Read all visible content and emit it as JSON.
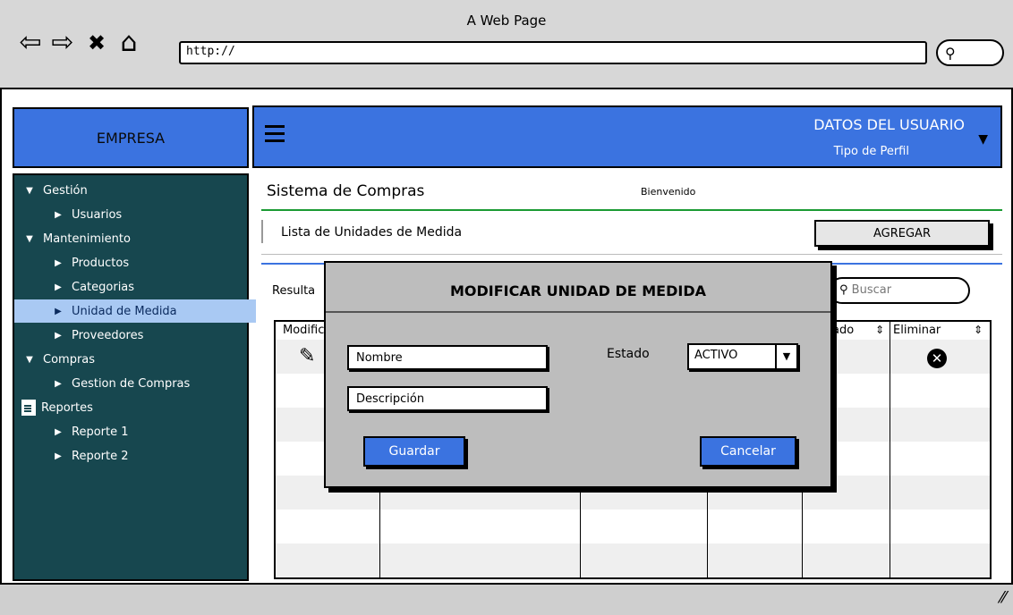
{
  "window": {
    "title": "A Web Page"
  },
  "browser": {
    "url": "http://",
    "icons": [
      "back-icon",
      "forward-icon",
      "stop-icon",
      "home-icon",
      "search-icon"
    ]
  },
  "header": {
    "brand": "EMPRESA",
    "user_title": "DATOS DEL USUARIO",
    "user_subtitle": "Tipo de Perfil"
  },
  "sidebar": {
    "items": [
      {
        "label": "Gestión",
        "level": 0,
        "expanded": true
      },
      {
        "label": "Usuarios",
        "level": 1
      },
      {
        "label": "Mantenimiento",
        "level": 0,
        "expanded": true
      },
      {
        "label": "Productos",
        "level": 1
      },
      {
        "label": "Categorias",
        "level": 1
      },
      {
        "label": "Unidad de Medida",
        "level": 1,
        "selected": true
      },
      {
        "label": "Proveedores",
        "level": 1
      },
      {
        "label": "Compras",
        "level": 0,
        "expanded": true
      },
      {
        "label": "Gestion de Compras",
        "level": 1
      },
      {
        "label": "Reportes",
        "level": 0,
        "icon": "document-icon"
      },
      {
        "label": "Reporte 1",
        "level": 1
      },
      {
        "label": "Reporte 2",
        "level": 1
      }
    ]
  },
  "main": {
    "title": "Sistema de Compras",
    "welcome": "Bienvenido",
    "list_title": "Lista de Unidades de Medida",
    "add_button": "AGREGAR",
    "results_label": "Resulta",
    "search_placeholder": "Buscar",
    "table": {
      "headers": [
        "Modific",
        "ado",
        "Eliminar"
      ]
    }
  },
  "modal": {
    "title": "MODIFICAR UNIDAD DE MEDIDA",
    "nombre_placeholder": "Nombre",
    "descripcion_placeholder": "Descripción",
    "estado_label": "Estado",
    "estado_value": "ACTIVO",
    "save_button": "Guardar",
    "cancel_button": "Cancelar"
  },
  "colors": {
    "accent": "#3b73e0",
    "sidebar_bg": "#17474f",
    "selected_bg": "#a9c9f3",
    "modal_bg": "#bdbdbd"
  }
}
